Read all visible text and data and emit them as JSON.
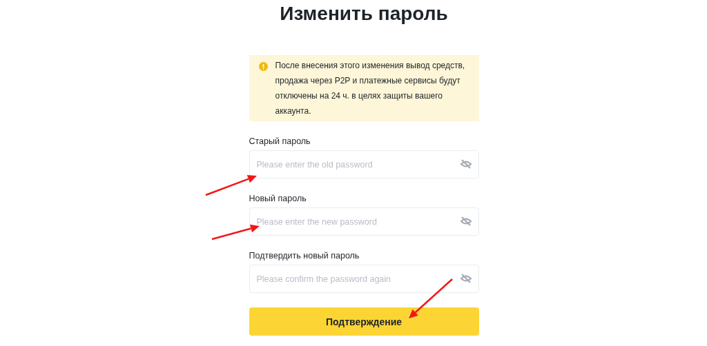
{
  "title": "Изменить пароль",
  "notice": {
    "text": "После внесения этого изменения вывод средств, продажа через P2P и платежные сервисы будут отключены на 24 ч. в целях защиты вашего аккаунта."
  },
  "fields": [
    {
      "label": "Старый пароль",
      "placeholder": "Please enter the old password"
    },
    {
      "label": "Новый пароль",
      "placeholder": "Please enter the new password"
    },
    {
      "label": "Подтвердить новый пароль",
      "placeholder": "Please confirm the password again"
    }
  ],
  "submit_button": "Подтверждение"
}
